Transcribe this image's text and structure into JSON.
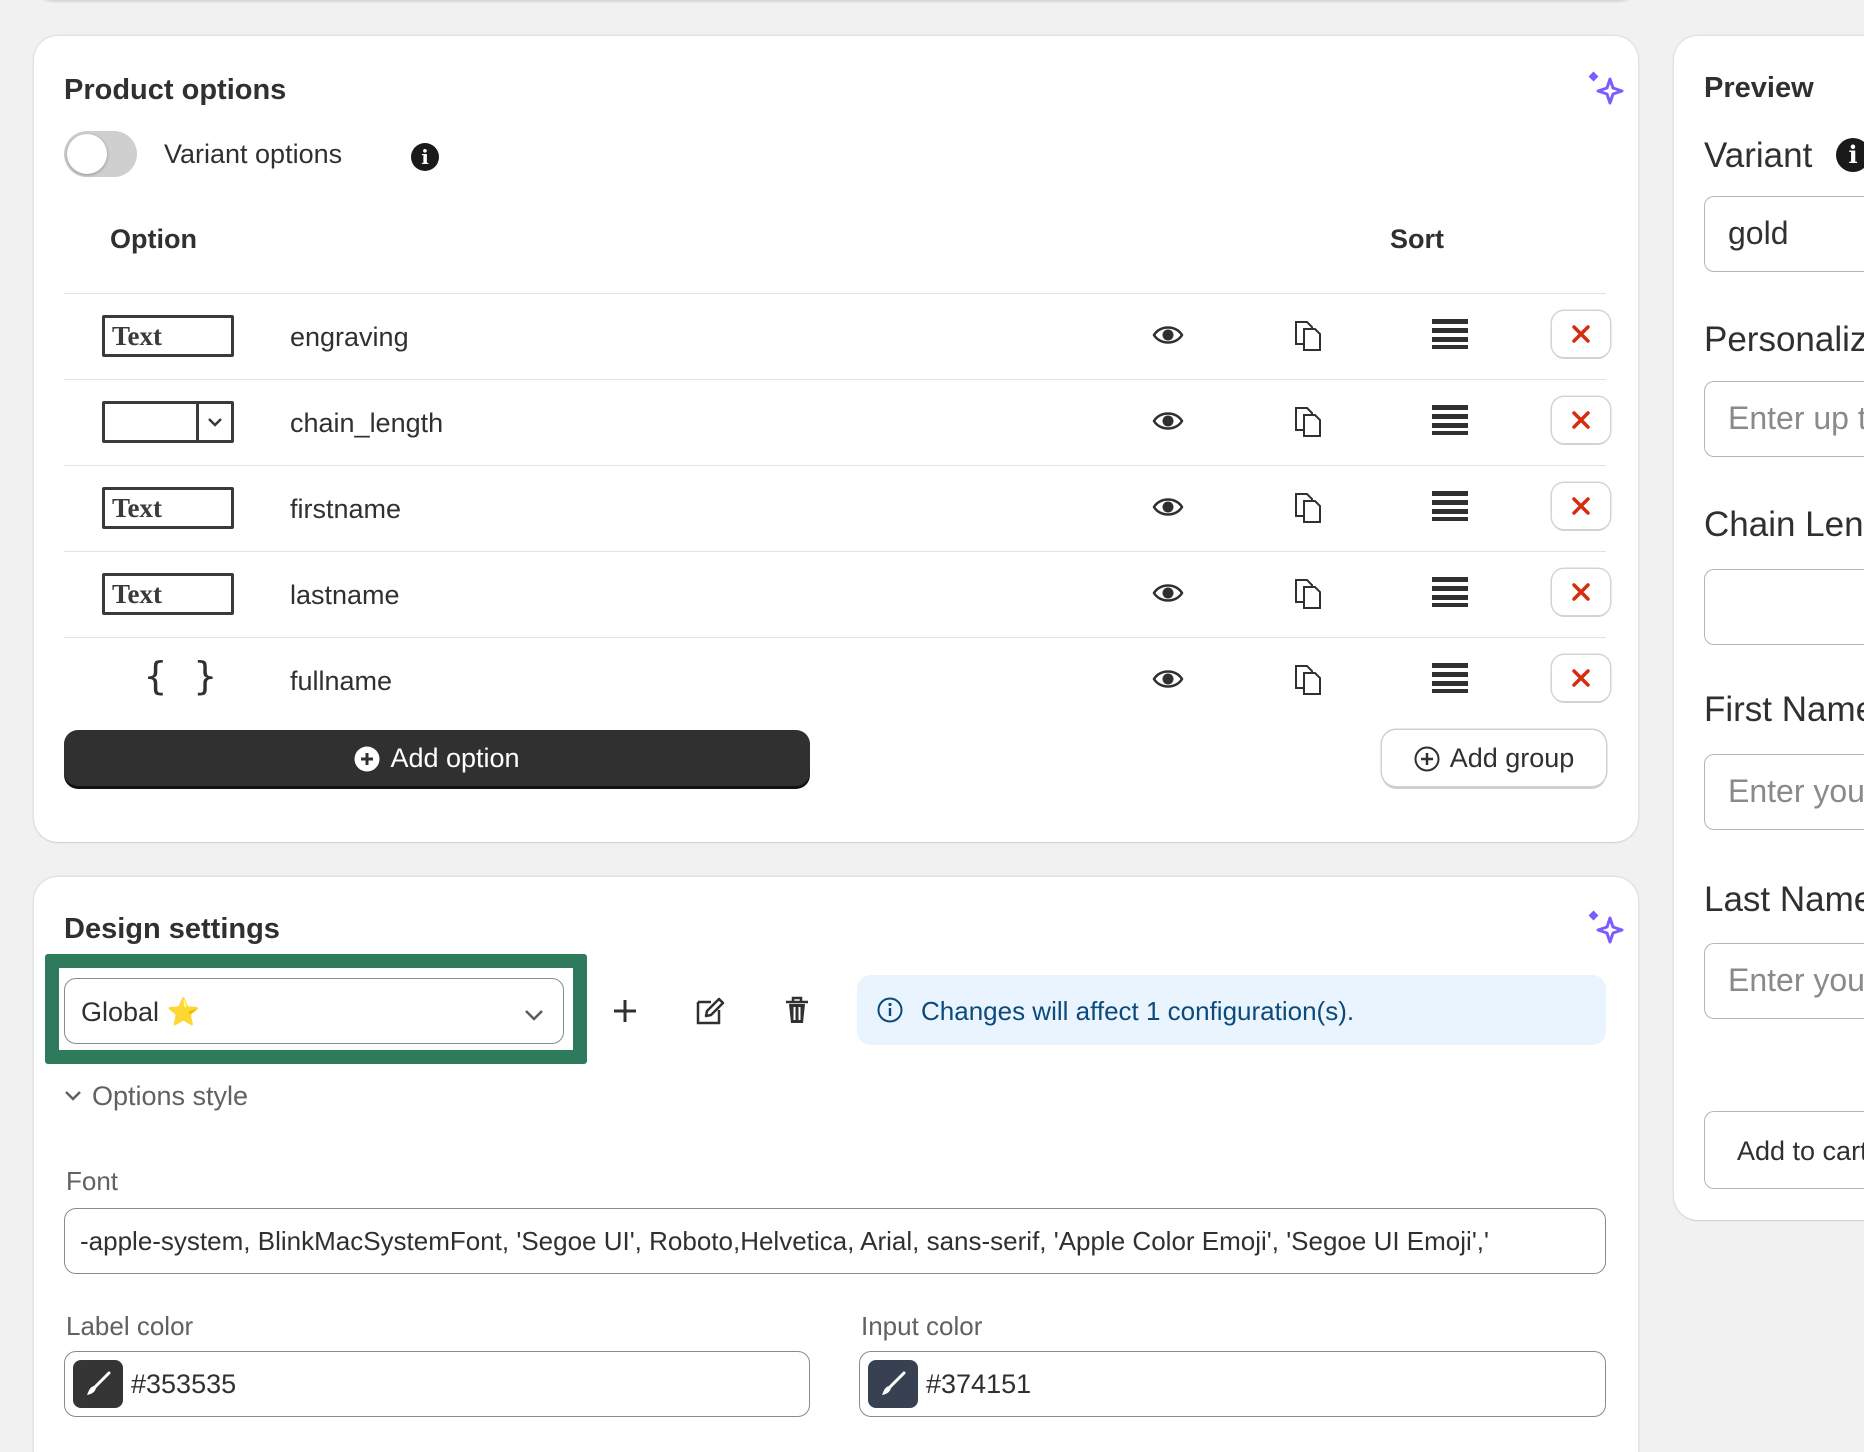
{
  "product_options": {
    "title": "Product options",
    "toggle_label": "Variant options",
    "toggle_on": false,
    "col_option": "Option",
    "col_sort": "Sort",
    "rows": [
      {
        "type": "text",
        "type_label": "Text",
        "name": "engraving"
      },
      {
        "type": "select",
        "type_label": "",
        "name": "chain_length"
      },
      {
        "type": "text",
        "type_label": "Text",
        "name": "firstname"
      },
      {
        "type": "text",
        "type_label": "Text",
        "name": "lastname"
      },
      {
        "type": "formula",
        "type_label": "{ }",
        "name": "fullname"
      }
    ],
    "add_option": "Add option",
    "add_group": "Add group"
  },
  "design_settings": {
    "title": "Design settings",
    "selected": "Global ⭐",
    "banner": "Changes will affect 1 configuration(s).",
    "section": "Options style",
    "font_label": "Font",
    "font_value": "-apple-system, BlinkMacSystemFont, 'Segoe UI', Roboto,Helvetica, Arial, sans-serif, 'Apple Color Emoji', 'Segoe UI Emoji','",
    "label_color_label": "Label color",
    "label_color": "#353535",
    "input_color_label": "Input color",
    "input_color": "#374151"
  },
  "preview": {
    "title": "Preview",
    "variant_label": "Variant",
    "variant_value": "gold",
    "personalization_label": "Personaliz",
    "personalization_placeholder": "Enter up t",
    "chain_label": "Chain Len",
    "first_label": "First Name",
    "first_placeholder": "Enter you",
    "last_label": "Last Name",
    "last_placeholder": "Enter you",
    "add_to_cart": "Add to cart"
  },
  "colors": {
    "accent_dark": "#303030",
    "highlight": "#2d7a5c",
    "sparkle": "#7c5cff",
    "delete": "#d72c0d",
    "banner_bg": "#eaf4ff"
  }
}
